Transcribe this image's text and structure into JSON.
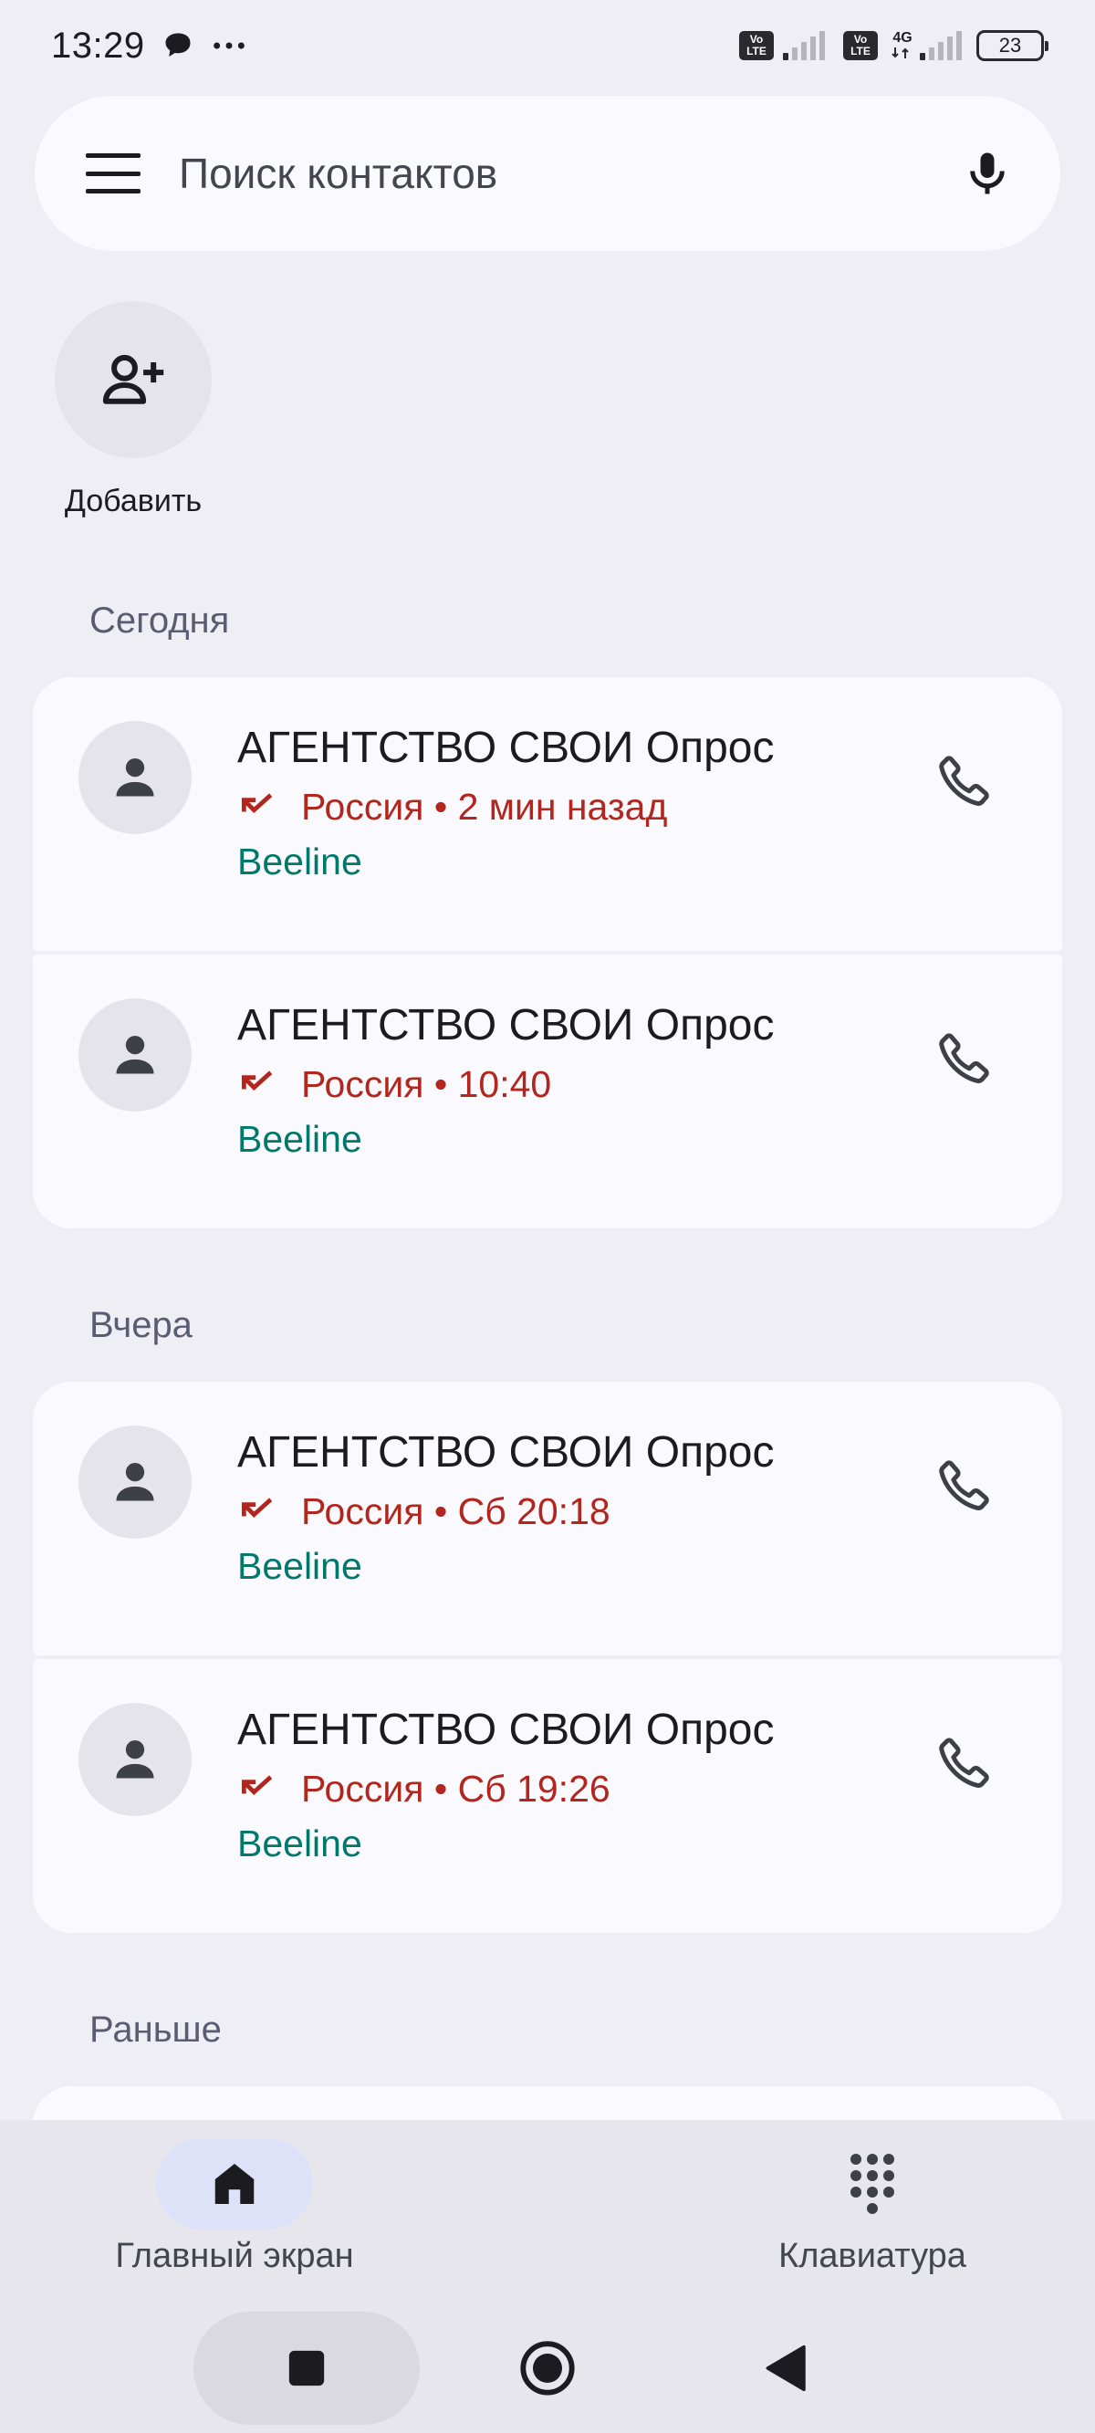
{
  "status_bar": {
    "time": "13:29",
    "notification_icons": [
      "chat-bubble-icon",
      "more-dots-icon"
    ],
    "sim1_label": "VoLTE",
    "sim2_label": "VoLTE",
    "network_type": "4G",
    "battery_level": "23"
  },
  "search": {
    "placeholder": "Поиск контактов"
  },
  "add_contact": {
    "label": "Добавить"
  },
  "sections": [
    {
      "header": "Сегодня",
      "calls": [
        {
          "name": "АГЕНТСТВО СВОИ Опрос",
          "location": "Россия",
          "time": "2 мин назад",
          "carrier": "Beeline",
          "call_type": "missed"
        },
        {
          "name": "АГЕНТСТВО СВОИ Опрос",
          "location": "Россия",
          "time": "10:40",
          "carrier": "Beeline",
          "call_type": "missed"
        }
      ]
    },
    {
      "header": "Вчера",
      "calls": [
        {
          "name": "АГЕНТСТВО СВОИ Опрос",
          "location": "Россия",
          "time": "Сб 20:18",
          "carrier": "Beeline",
          "call_type": "missed"
        },
        {
          "name": "АГЕНТСТВО СВОИ Опрос",
          "location": "Россия",
          "time": "Сб 19:26",
          "carrier": "Beeline",
          "call_type": "missed"
        }
      ]
    },
    {
      "header": "Раньше",
      "calls": []
    }
  ],
  "meta_strings": {
    "c0": "Россия • 2 мин назад",
    "c1": "Россия • 10:40",
    "c2": "Россия • Сб 20:18",
    "c3": "Россия • Сб 19:26"
  },
  "bottom_nav": {
    "items": [
      {
        "label": "Главный экран",
        "icon": "home-icon",
        "active": true
      },
      {
        "label": "Клавиатура",
        "icon": "dialpad-icon",
        "active": false
      }
    ]
  },
  "colors": {
    "background": "#EEEEF4",
    "card": "#F9F9FE",
    "missed_call": "#B3261E",
    "carrier": "#00796B",
    "active_nav_pill": "#DDE2F8"
  }
}
